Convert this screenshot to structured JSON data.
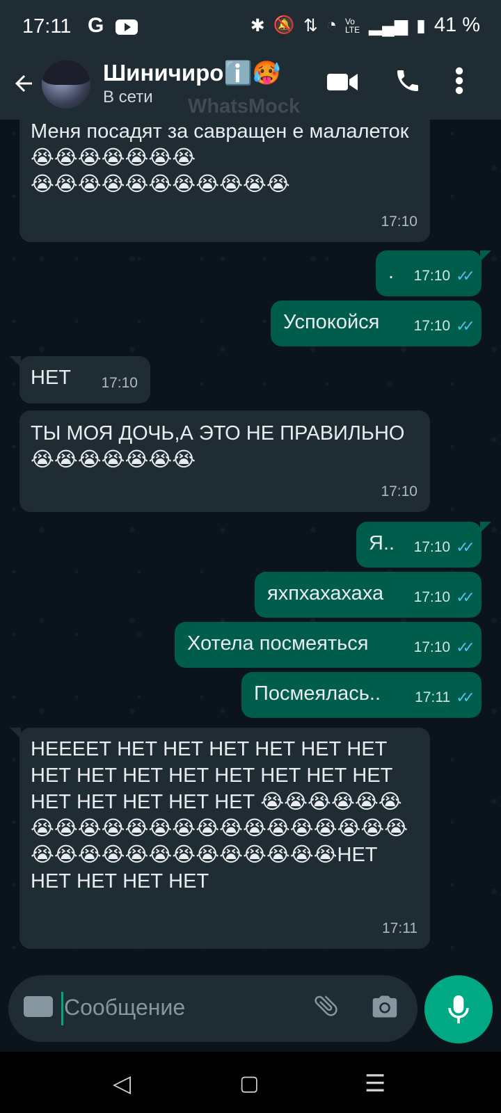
{
  "status_bar": {
    "time": "17:11",
    "google_letter": "G",
    "network": "Vo LTE",
    "battery": "41 %"
  },
  "header": {
    "contact_name": "Шиничиро",
    "name_emojis": "ℹ️🥵",
    "status": "В сети",
    "watermark": "WhatsMock"
  },
  "messages": [
    {
      "direction": "in",
      "text": "Меня посадят за савращен е малалеток😭😭😭😭😭😭😭\n😭😭😭😭😭😭😭😭😭😭😭",
      "time": "17:10"
    },
    {
      "direction": "out",
      "text": ".",
      "time": "17:10",
      "read": true
    },
    {
      "direction": "out",
      "text": "Успокойся",
      "time": "17:10",
      "read": true
    },
    {
      "direction": "in",
      "text": "НЕТ",
      "time": "17:10"
    },
    {
      "direction": "in",
      "text": "ТЫ МОЯ ДОЧЬ,А ЭТО НЕ ПРАВИЛЬНО😭😭😭😭😭😭😭",
      "time": "17:10"
    },
    {
      "direction": "out",
      "text": "Я..",
      "time": "17:10",
      "read": true
    },
    {
      "direction": "out",
      "text": "яхпхахахаха",
      "time": "17:10",
      "read": true
    },
    {
      "direction": "out",
      "text": "Хотела посмеяться",
      "time": "17:10",
      "read": true
    },
    {
      "direction": "out",
      "text": "Посмеялась..",
      "time": "17:11",
      "read": true
    },
    {
      "direction": "in",
      "text": "НЕЕЕЕТ НЕТ НЕТ НЕТ НЕТ НЕТ НЕТ НЕТ НЕТ НЕТ НЕТ НЕТ НЕТ НЕТ НЕТ НЕТ НЕТ НЕТ НЕТ НЕТ 😭😭😭😭😭😭😭😭😭😭😭😭😭😭😭😭😭😭😭😭😭😭😭😭😭😭😭😭😭😭😭😭😭😭😭НЕТ НЕТ НЕТ НЕТ НЕТ",
      "time": "17:11"
    }
  ],
  "composer": {
    "placeholder": "Сообщение"
  },
  "icons": {
    "back": "arrow-left-icon",
    "video": "video-call-icon",
    "call": "phone-icon",
    "menu": "more-vert-icon",
    "keyboard": "keyboard-icon",
    "attach": "paperclip-icon",
    "camera": "camera-icon",
    "mic": "mic-icon"
  },
  "colors": {
    "bar": "#202c33",
    "incoming": "#202c33",
    "outgoing": "#005c4b",
    "accent": "#00a884",
    "read_ticks": "#53bdeb"
  }
}
